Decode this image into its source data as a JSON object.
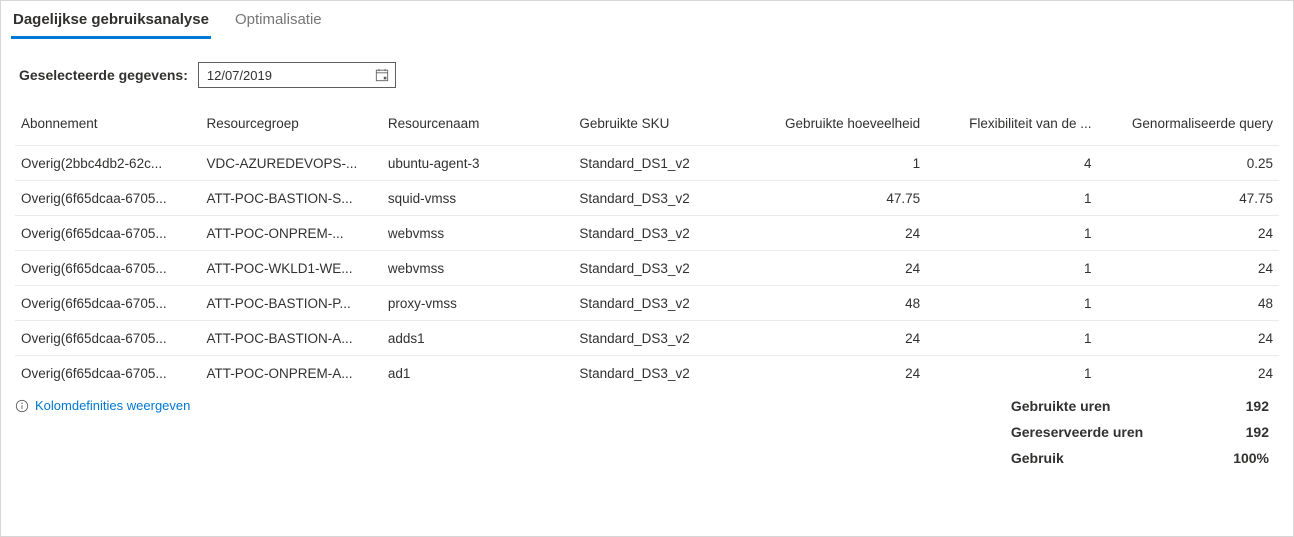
{
  "tabs": {
    "daily": "Dagelijkse gebruiksanalyse",
    "opt": "Optimalisatie"
  },
  "filter": {
    "label": "Geselecteerde gegevens:",
    "date_value": "12/07/2019"
  },
  "columns": {
    "c0": "Abonnement",
    "c1": "Resourcegroep",
    "c2": "Resourcenaam",
    "c3": "Gebruikte SKU",
    "c4": "Gebruikte hoeveelheid",
    "c5": "Flexibiliteit van de ...",
    "c6": "Genormaliseerde query"
  },
  "rows": [
    {
      "sub": "Overig(2bbc4db2-62c...",
      "rg": "VDC-AZUREDEVOPS-...",
      "name": "ubuntu-agent-3",
      "sku": "Standard_DS1_v2",
      "qty": "1",
      "flex": "4",
      "norm": "0.25"
    },
    {
      "sub": "Overig(6f65dcaa-6705...",
      "rg": "ATT-POC-BASTION-S...",
      "name": "squid-vmss",
      "sku": "Standard_DS3_v2",
      "qty": "47.75",
      "flex": "1",
      "norm": "47.75"
    },
    {
      "sub": "Overig(6f65dcaa-6705...",
      "rg": "ATT-POC-ONPREM-...",
      "name": "webvmss",
      "sku": "Standard_DS3_v2",
      "qty": "24",
      "flex": "1",
      "norm": "24"
    },
    {
      "sub": "Overig(6f65dcaa-6705...",
      "rg": "ATT-POC-WKLD1-WE...",
      "name": "webvmss",
      "sku": "Standard_DS3_v2",
      "qty": "24",
      "flex": "1",
      "norm": "24"
    },
    {
      "sub": "Overig(6f65dcaa-6705...",
      "rg": "ATT-POC-BASTION-P...",
      "name": "proxy-vmss",
      "sku": "Standard_DS3_v2",
      "qty": "48",
      "flex": "1",
      "norm": "48"
    },
    {
      "sub": "Overig(6f65dcaa-6705...",
      "rg": "ATT-POC-BASTION-A...",
      "name": "adds1",
      "sku": "Standard_DS3_v2",
      "qty": "24",
      "flex": "1",
      "norm": "24"
    },
    {
      "sub": "Overig(6f65dcaa-6705...",
      "rg": "ATT-POC-ONPREM-A...",
      "name": "ad1",
      "sku": "Standard_DS3_v2",
      "qty": "24",
      "flex": "1",
      "norm": "24"
    }
  ],
  "footer_link": "Kolomdefinities weergeven",
  "summary": {
    "used_label": "Gebruikte uren",
    "used_val": "192",
    "reserved_label": "Gereserveerde uren",
    "reserved_val": "192",
    "usage_label": "Gebruik",
    "usage_val": "100%"
  }
}
